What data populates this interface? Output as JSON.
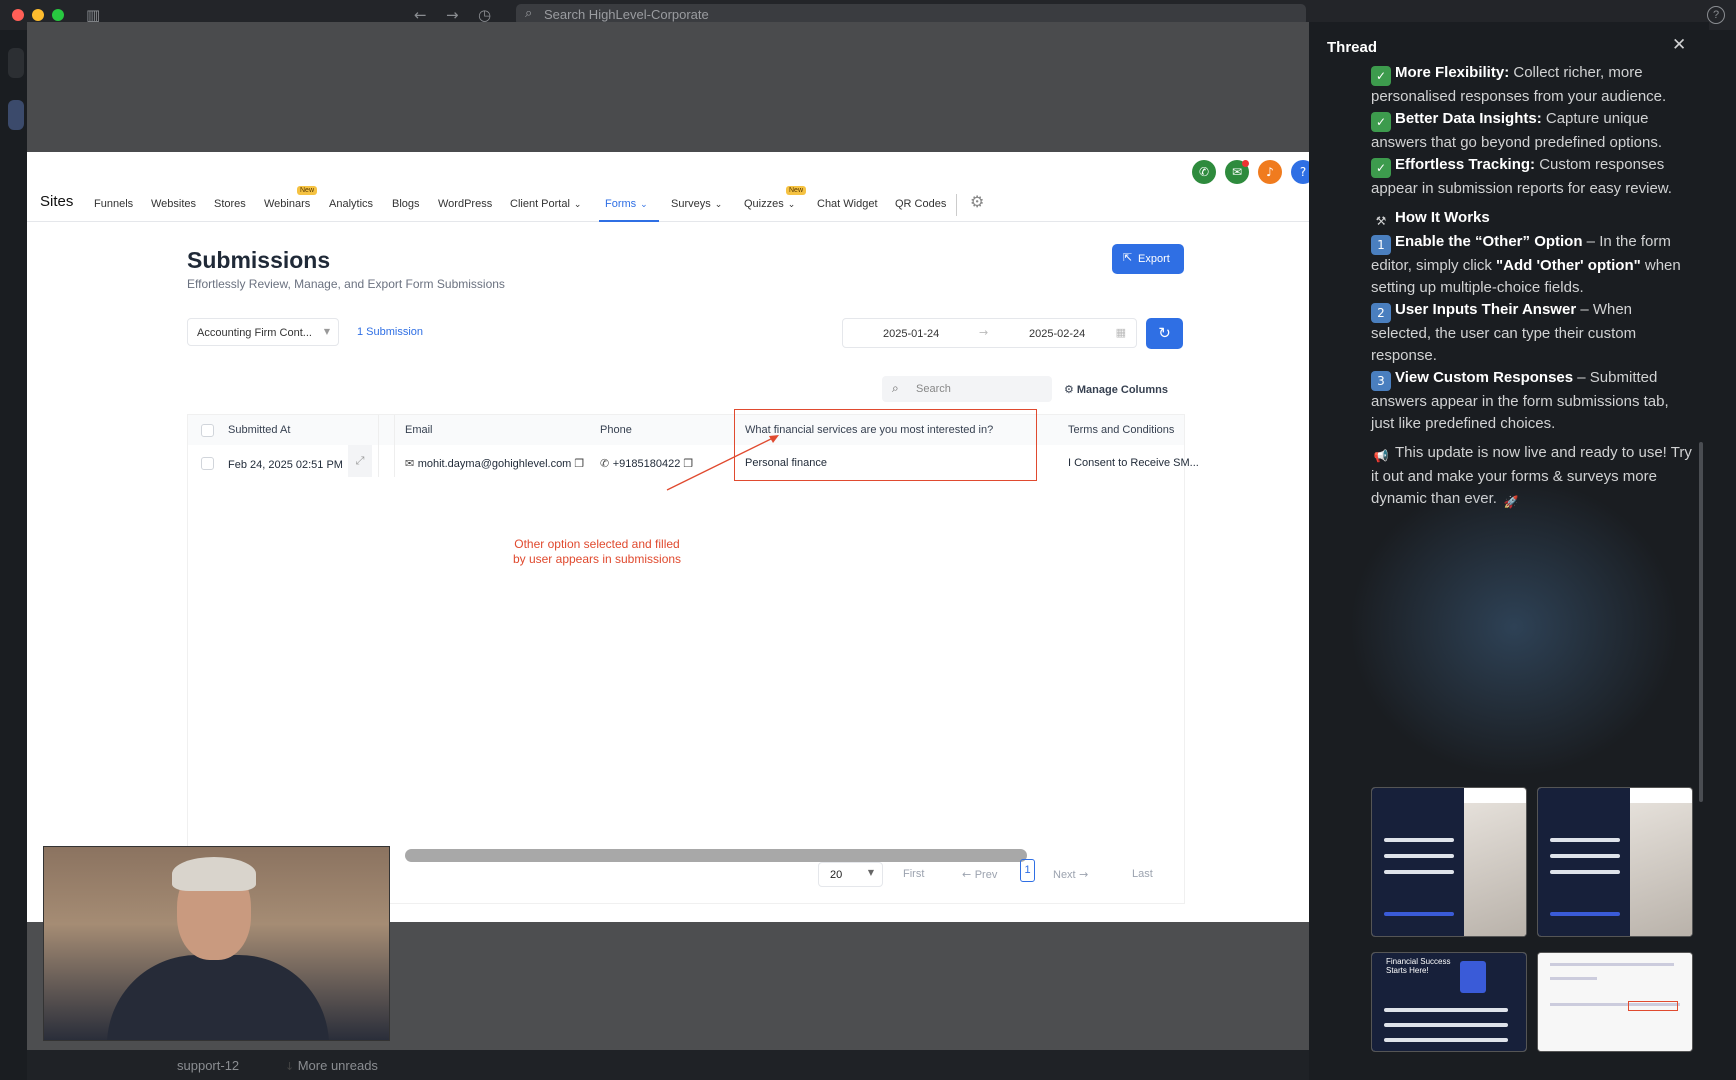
{
  "window": {
    "search_placeholder": "Search HighLevel-Corporate"
  },
  "bottom_bar": {
    "channel": "support-12",
    "more_unreads": "More unreads"
  },
  "app": {
    "nav": {
      "brand": "Sites",
      "items": [
        "Funnels",
        "Websites",
        "Stores",
        "Webinars",
        "Analytics",
        "Blogs",
        "WordPress",
        "Client Portal",
        "Forms",
        "Surveys",
        "Quizzes",
        "Chat Widget",
        "QR Codes"
      ],
      "new_badge": "New",
      "active": "Forms"
    },
    "page": {
      "title": "Submissions",
      "subtitle": "Effortlessly Review, Manage, and Export Form Submissions",
      "export_label": "Export"
    },
    "filters": {
      "form_select": "Accounting Firm Cont...",
      "submission_count": "1 Submission",
      "date_from": "2025-01-24",
      "date_to": "2025-02-24"
    },
    "toolbar": {
      "search_placeholder": "Search",
      "manage_columns": "Manage Columns"
    },
    "table": {
      "headers": [
        "Submitted At",
        "Email",
        "Phone",
        "What financial services are you most interested in?",
        "Terms and Conditions"
      ],
      "rows": [
        {
          "submitted_at": "Feb 24, 2025 02:51 PM",
          "email": "mohit.dayma@gohighlevel.com",
          "phone": "+9185180422",
          "financial_services": "Personal finance",
          "terms": "I Consent to Receive SM..."
        }
      ]
    },
    "annotation": {
      "line1": "Other option selected and filled",
      "line2": "by user appears in submissions"
    },
    "pagination": {
      "page_size": "20",
      "first": "First",
      "prev": "Prev",
      "current": "1",
      "next": "Next",
      "last": "Last"
    }
  },
  "thread": {
    "title": "Thread",
    "items": [
      {
        "icon": "check",
        "bold": "More Flexibility:",
        "text": " Collect richer, more personalised responses from your audience."
      },
      {
        "icon": "check",
        "bold": "Better Data Insights:",
        "text": " Capture unique answers that go beyond predefined options."
      },
      {
        "icon": "check",
        "bold": "Effortless Tracking:",
        "text": " Custom responses appear in submission reports for easy review."
      }
    ],
    "how_heading": "How It Works",
    "steps": [
      {
        "num": "1",
        "bold": "Enable the “Other” Option",
        "text": " – In the form editor, simply click ",
        "bold2": "\"Add 'Other' option\"",
        "text2": " when setting up multiple-choice fields."
      },
      {
        "num": "2",
        "bold": "User Inputs Their Answer",
        "text": " – When selected, the user can type their custom response."
      },
      {
        "num": "3",
        "bold": "View Custom Responses",
        "text": " – Submitted answers appear in the form submissions tab, just like predefined choices."
      }
    ],
    "closing": "This update is now live and ready to use! Try it out and make your forms & surveys more dynamic than ever.",
    "thumb_text": "Financial Success Starts Here!"
  }
}
